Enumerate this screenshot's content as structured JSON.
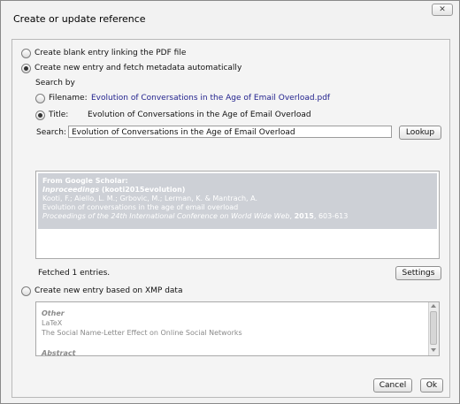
{
  "window": {
    "title": "Create or update reference",
    "close_glyph": "✕"
  },
  "options": {
    "blank_entry": "Create blank entry linking the PDF file",
    "new_entry_fetch": "Create new entry and fetch metadata automatically",
    "search_by": "Search by",
    "filename_label": "Filename:",
    "filename_value": "Evolution of Conversations in the Age of Email Overload.pdf",
    "title_label": "Title:",
    "title_value": "Evolution of Conversations in the Age of Email Overload",
    "search_label": "Search:",
    "search_value": "Evolution of Conversations in the Age of Email Overload",
    "lookup_button": "Lookup",
    "xmp_entry": "Create new entry based on XMP data"
  },
  "result": {
    "source": "From Google Scholar:",
    "type": "Inproceedings",
    "key": "(kooti2015evolution)",
    "authors": "Kooti, F.; Aiello, L. M.; Grbovic, M.; Lerman, K. & Mantrach, A.",
    "title": "Evolution of conversations in the age of email overload",
    "venue": "Proceedings of the 24th International Conference on World Wide Web",
    "year": "2015",
    "pages": "603-613"
  },
  "status": {
    "fetched": "Fetched 1 entries.",
    "settings_button": "Settings"
  },
  "xmp": {
    "category": "Other",
    "type": "LaTeX",
    "title": "The Social Name-Letter Effect on Online Social Networks",
    "partial": "Abstract"
  },
  "footer": {
    "cancel_button": "Cancel",
    "ok_button": "Ok"
  },
  "selected_option": "new_entry_fetch",
  "selected_search_by": "title"
}
